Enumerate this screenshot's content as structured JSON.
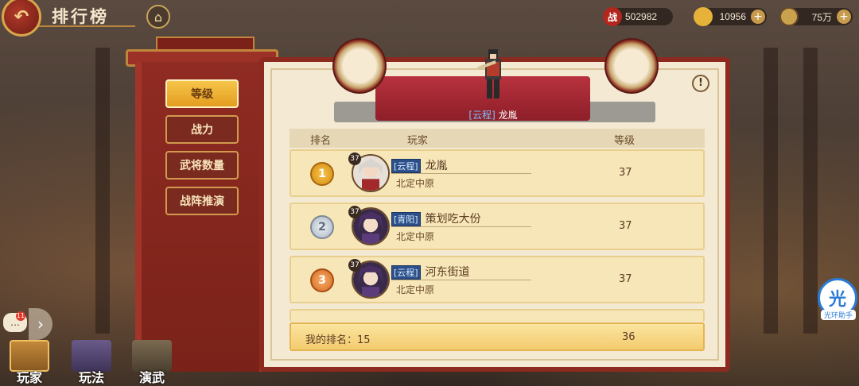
{
  "header": {
    "title": "排行榜",
    "back_icon": "back-icon",
    "home_icon": "home-icon"
  },
  "resources": [
    {
      "icon": "battle-power-icon",
      "glyph": "战",
      "value": "502982",
      "has_plus": false
    },
    {
      "icon": "gold-ingot-icon",
      "glyph": "",
      "value": "10956",
      "has_plus": true
    },
    {
      "icon": "coin-icon",
      "glyph": "",
      "value": "75万",
      "has_plus": true
    }
  ],
  "tabs": [
    {
      "label": "等级",
      "active": true
    },
    {
      "label": "战力",
      "active": false
    },
    {
      "label": "武将数量",
      "active": false
    },
    {
      "label": "战阵推演",
      "active": false
    }
  ],
  "champion": {
    "guild": "[云程]",
    "name": "龙胤"
  },
  "table": {
    "headers": {
      "rank": "排名",
      "player": "玩家",
      "level": "等级"
    },
    "rows": [
      {
        "rank": "1",
        "avatar_level": "37",
        "guild": "[云程]",
        "name": "龙胤",
        "server": "北定中原",
        "level": "37"
      },
      {
        "rank": "2",
        "avatar_level": "37",
        "guild": "[青阳]",
        "name": "策划吃大份",
        "server": "北定中原",
        "level": "37"
      },
      {
        "rank": "3",
        "avatar_level": "37",
        "guild": "[云程]",
        "name": "河东街道",
        "server": "北定中原",
        "level": "37"
      }
    ]
  },
  "my_rank": {
    "label": "我的排名：15",
    "level": "36"
  },
  "bottom_nav": [
    {
      "label": "玩家",
      "active": true
    },
    {
      "label": "玩法",
      "active": false
    },
    {
      "label": "演武",
      "active": false
    }
  ],
  "chat": {
    "badge": "11"
  },
  "helper": {
    "glyph": "光",
    "label": "光环助手"
  },
  "colors": {
    "panel_red": "#8c2a20",
    "gold": "#e39d20",
    "paper": "#f4ead3"
  }
}
